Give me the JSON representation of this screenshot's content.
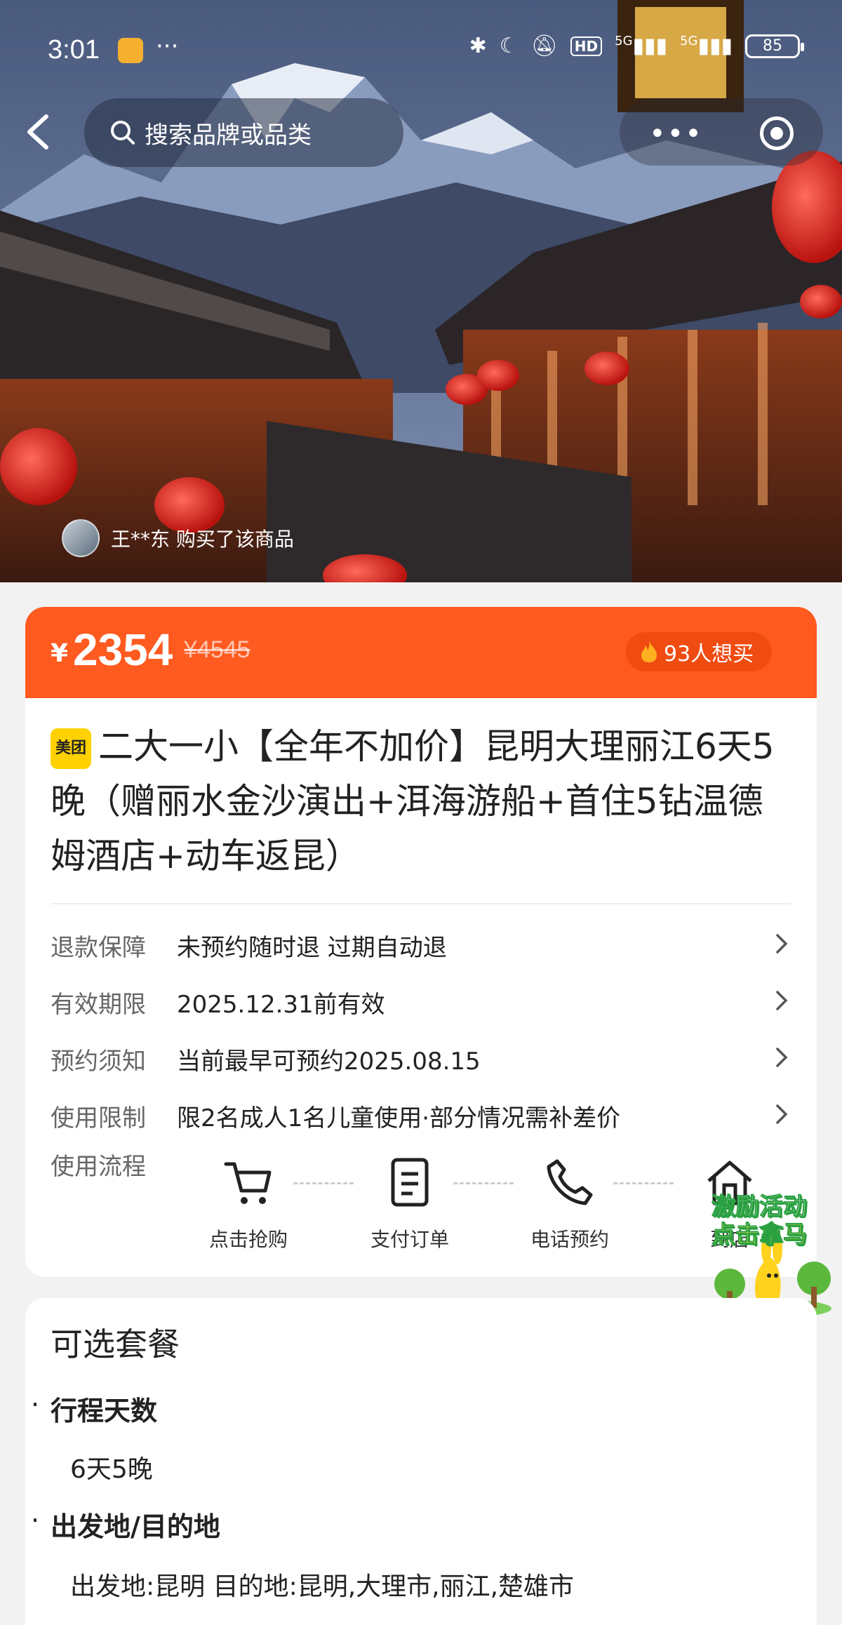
{
  "status_bar": {
    "time": "3:01",
    "more": "···",
    "network1": "5G",
    "network2": "5G",
    "hd_label": "HD",
    "battery": "85"
  },
  "nav": {
    "search_placeholder": "搜索品牌或品类",
    "menu_dots": "•••"
  },
  "buyer_ticker": "王**东 购买了该商品",
  "price": {
    "currency": "¥",
    "current": "2354",
    "original": "¥4545",
    "want_count": "93人想买"
  },
  "product": {
    "brand_badge": "美团",
    "title": "二大一小【全年不加价】昆明大理丽江6天5晚（赠丽水金沙演出+洱海游船+首住5钻温德姆酒店+动车返昆）"
  },
  "info_rows": [
    {
      "key": "退款保障",
      "value": "未预约随时退 过期自动退"
    },
    {
      "key": "有效期限",
      "value": "2025.12.31前有效"
    },
    {
      "key": "预约须知",
      "value": "当前最早可预约2025.08.15"
    },
    {
      "key": "使用限制",
      "value": "限2名成人1名儿童使用·部分情况需补差价"
    }
  ],
  "flow": {
    "label": "使用流程",
    "steps": [
      "点击抢购",
      "支付订单",
      "电话预约",
      "到店"
    ]
  },
  "promo": {
    "line1": "激励活动",
    "line2": "点击拿马"
  },
  "options": {
    "title": "可选套餐",
    "groups": [
      {
        "heading": "行程天数",
        "value": "6天5晚"
      },
      {
        "heading": "出发地/目的地",
        "value": "出发地:昆明 目的地:昆明,大理市,丽江,楚雄市"
      }
    ]
  },
  "colors": {
    "accent": "#ff5a1f",
    "brand_yellow": "#ffd100"
  }
}
